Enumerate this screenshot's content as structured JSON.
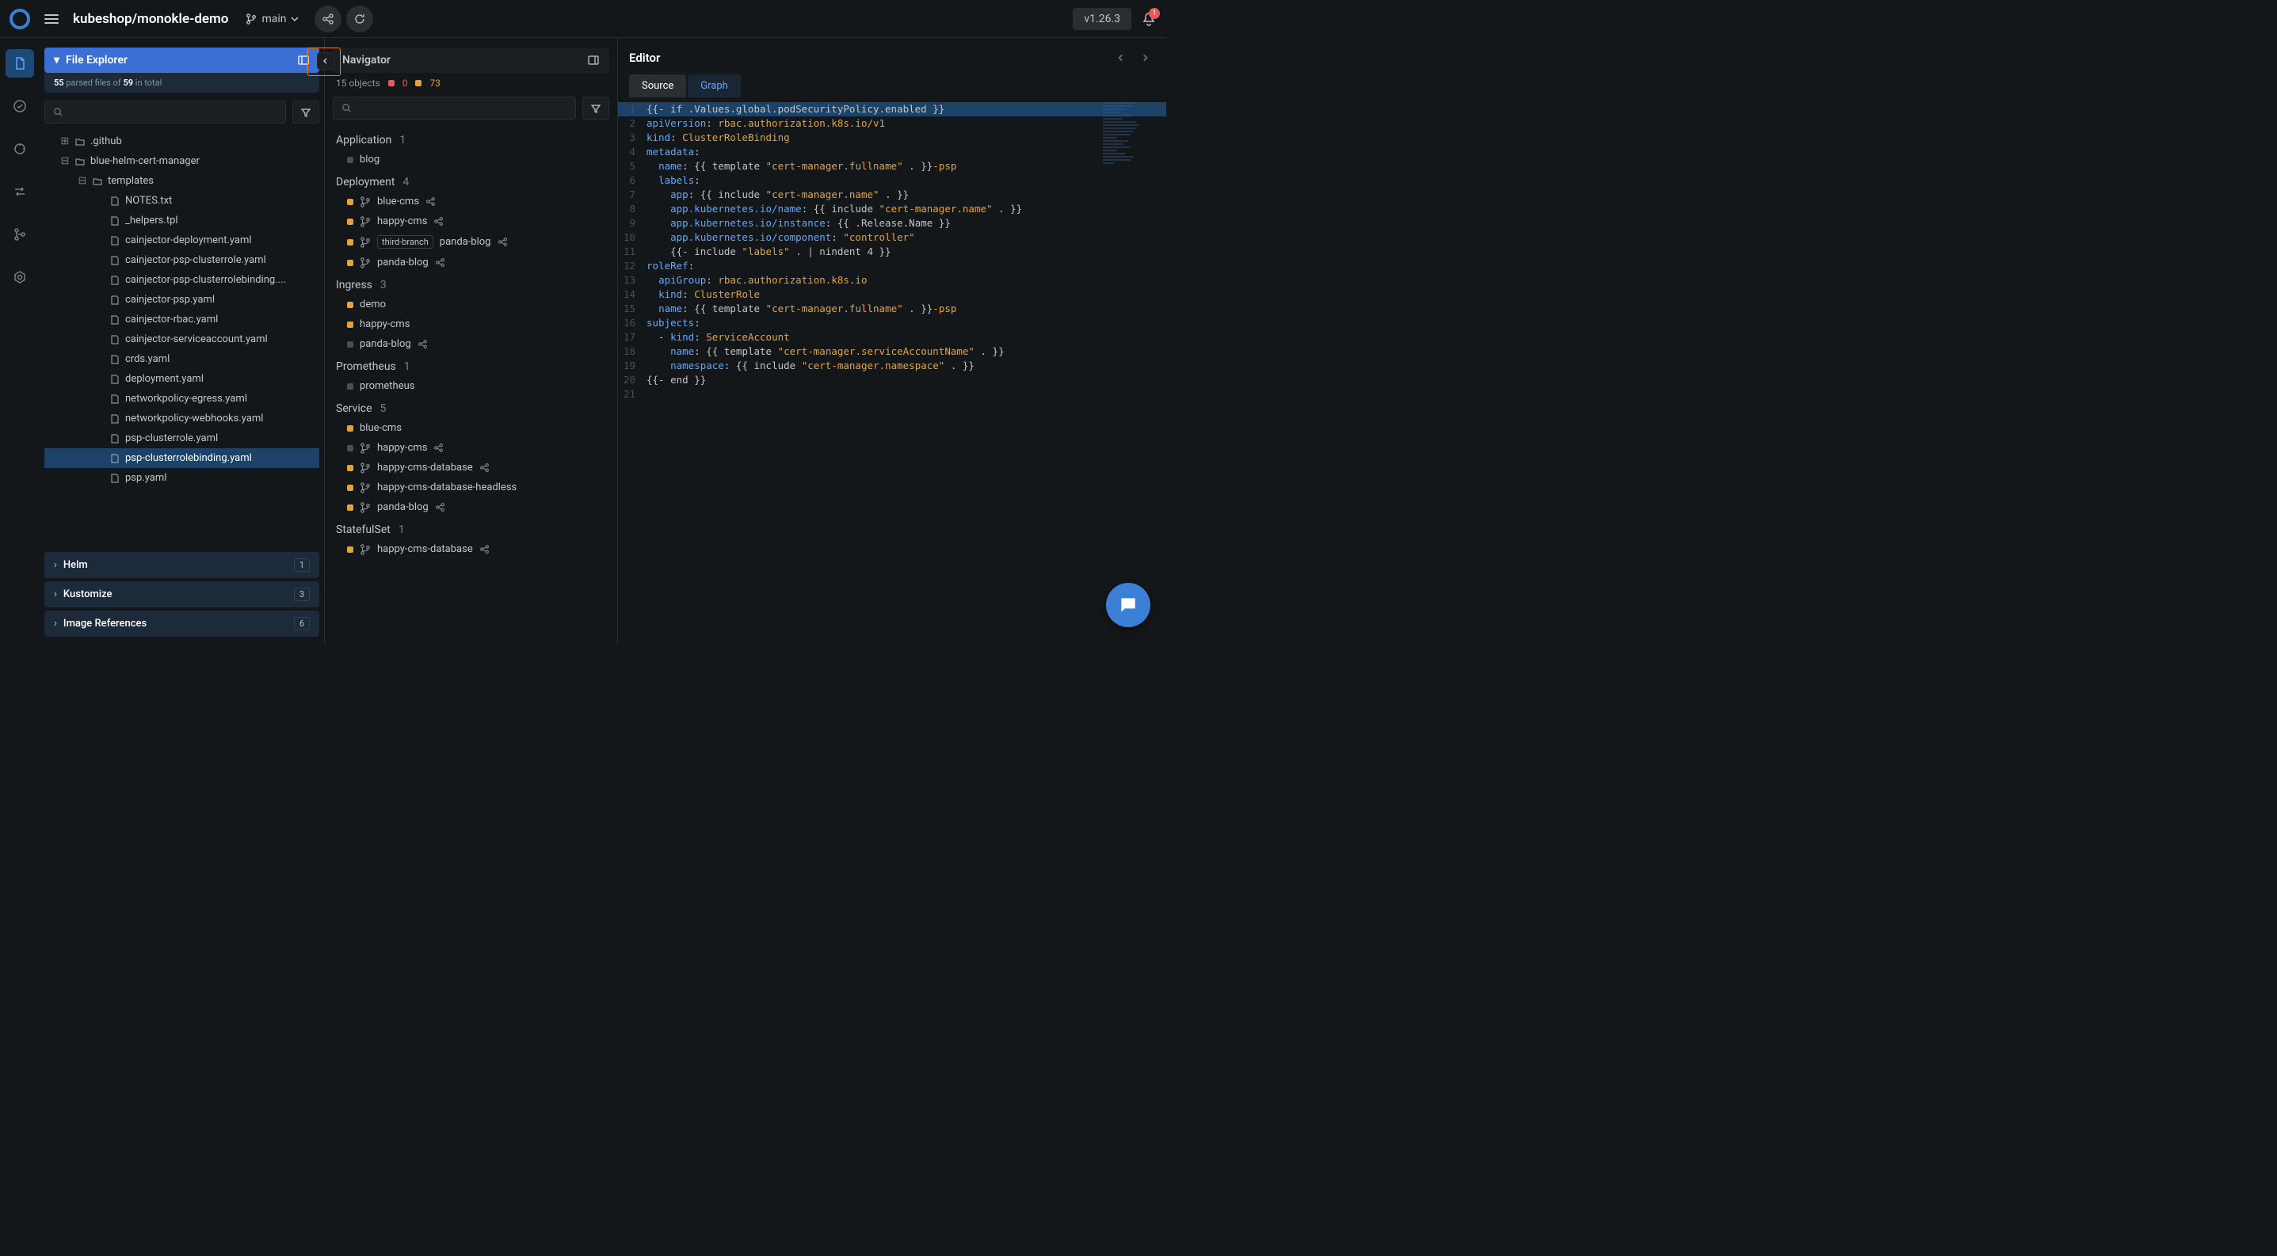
{
  "header": {
    "project": "kubeshop/monokle-demo",
    "branch": "main",
    "version": "v1.26.3",
    "notif_count": "1"
  },
  "file_explorer": {
    "title": "File Explorer",
    "parsed_count": "55",
    "parsed_label_a": "parsed files of",
    "total_count": "59",
    "parsed_label_b": "in total",
    "tree": [
      {
        "name": ".github",
        "type": "folder",
        "depth": 0,
        "expand": "plus"
      },
      {
        "name": "blue-helm-cert-manager",
        "type": "folder",
        "depth": 0,
        "expand": "minus"
      },
      {
        "name": "templates",
        "type": "folder",
        "depth": 1,
        "expand": "minus"
      },
      {
        "name": "NOTES.txt",
        "type": "file",
        "depth": 2
      },
      {
        "name": "_helpers.tpl",
        "type": "file",
        "depth": 2
      },
      {
        "name": "cainjector-deployment.yaml",
        "type": "file",
        "depth": 2
      },
      {
        "name": "cainjector-psp-clusterrole.yaml",
        "type": "file",
        "depth": 2
      },
      {
        "name": "cainjector-psp-clusterrolebinding....",
        "type": "file",
        "depth": 2
      },
      {
        "name": "cainjector-psp.yaml",
        "type": "file",
        "depth": 2
      },
      {
        "name": "cainjector-rbac.yaml",
        "type": "file",
        "depth": 2
      },
      {
        "name": "cainjector-serviceaccount.yaml",
        "type": "file",
        "depth": 2
      },
      {
        "name": "crds.yaml",
        "type": "file",
        "depth": 2
      },
      {
        "name": "deployment.yaml",
        "type": "file",
        "depth": 2
      },
      {
        "name": "networkpolicy-egress.yaml",
        "type": "file",
        "depth": 2
      },
      {
        "name": "networkpolicy-webhooks.yaml",
        "type": "file",
        "depth": 2
      },
      {
        "name": "psp-clusterrole.yaml",
        "type": "file",
        "depth": 2
      },
      {
        "name": "psp-clusterrolebinding.yaml",
        "type": "file",
        "depth": 2,
        "selected": true
      },
      {
        "name": "psp.yaml",
        "type": "file",
        "depth": 2
      }
    ],
    "sections": [
      {
        "label": "Helm",
        "count": "1"
      },
      {
        "label": "Kustomize",
        "count": "3"
      },
      {
        "label": "Image References",
        "count": "6"
      }
    ]
  },
  "navigator": {
    "title": "Navigator",
    "objects_label": "15 objects",
    "red_count": "0",
    "orange_count": "73",
    "groups": [
      {
        "name": "Application",
        "count": "1",
        "items": [
          {
            "name": "blog",
            "status": "gray"
          }
        ]
      },
      {
        "name": "Deployment",
        "count": "4",
        "items": [
          {
            "name": "blue-cms",
            "status": "orange",
            "branch": true,
            "share": true
          },
          {
            "name": "happy-cms",
            "status": "orange",
            "branch": true,
            "share": true
          },
          {
            "name": "panda-blog",
            "status": "orange",
            "branch": true,
            "badge": "third-branch",
            "share": true
          },
          {
            "name": "panda-blog",
            "status": "orange",
            "branch": true,
            "share": true
          }
        ]
      },
      {
        "name": "Ingress",
        "count": "3",
        "items": [
          {
            "name": "demo",
            "status": "orange"
          },
          {
            "name": "happy-cms",
            "status": "orange"
          },
          {
            "name": "panda-blog",
            "status": "gray",
            "share": true
          }
        ]
      },
      {
        "name": "Prometheus",
        "count": "1",
        "items": [
          {
            "name": "prometheus",
            "status": "gray"
          }
        ]
      },
      {
        "name": "Service",
        "count": "5",
        "items": [
          {
            "name": "blue-cms",
            "status": "orange"
          },
          {
            "name": "happy-cms",
            "status": "gray",
            "branch": true,
            "share": true
          },
          {
            "name": "happy-cms-database",
            "status": "orange",
            "branch": true,
            "share": true
          },
          {
            "name": "happy-cms-database-headless",
            "status": "orange",
            "branch": true
          },
          {
            "name": "panda-blog",
            "status": "orange",
            "branch": true,
            "share": true
          }
        ]
      },
      {
        "name": "StatefulSet",
        "count": "1",
        "items": [
          {
            "name": "happy-cms-database",
            "status": "orange",
            "branch": true,
            "share": true
          }
        ]
      }
    ]
  },
  "editor": {
    "title": "Editor",
    "tabs": [
      {
        "label": "Source",
        "active": true
      },
      {
        "label": "Graph",
        "active": false
      }
    ],
    "code": [
      {
        "n": "1",
        "hl": true,
        "raw": "{{- if .Values.global.podSecurityPolicy.enabled }}"
      },
      {
        "n": "2",
        "raw": "apiVersion: rbac.authorization.k8s.io/v1"
      },
      {
        "n": "3",
        "raw": "kind: ClusterRoleBinding"
      },
      {
        "n": "4",
        "raw": "metadata:"
      },
      {
        "n": "5",
        "raw": "  name: {{ template \"cert-manager.fullname\" . }}-psp"
      },
      {
        "n": "6",
        "raw": "  labels:"
      },
      {
        "n": "7",
        "raw": "    app: {{ include \"cert-manager.name\" . }}"
      },
      {
        "n": "8",
        "raw": "    app.kubernetes.io/name: {{ include \"cert-manager.name\" . }}"
      },
      {
        "n": "9",
        "raw": "    app.kubernetes.io/instance: {{ .Release.Name }}"
      },
      {
        "n": "10",
        "raw": "    app.kubernetes.io/component: \"controller\""
      },
      {
        "n": "11",
        "raw": "    {{- include \"labels\" . | nindent 4 }}"
      },
      {
        "n": "12",
        "raw": "roleRef:"
      },
      {
        "n": "13",
        "raw": "  apiGroup: rbac.authorization.k8s.io"
      },
      {
        "n": "14",
        "raw": "  kind: ClusterRole"
      },
      {
        "n": "15",
        "raw": "  name: {{ template \"cert-manager.fullname\" . }}-psp"
      },
      {
        "n": "16",
        "raw": "subjects:"
      },
      {
        "n": "17",
        "raw": "  - kind: ServiceAccount"
      },
      {
        "n": "18",
        "raw": "    name: {{ template \"cert-manager.serviceAccountName\" . }}"
      },
      {
        "n": "19",
        "raw": "    namespace: {{ include \"cert-manager.namespace\" . }}"
      },
      {
        "n": "20",
        "raw": "{{- end }}"
      },
      {
        "n": "21",
        "raw": ""
      }
    ]
  }
}
